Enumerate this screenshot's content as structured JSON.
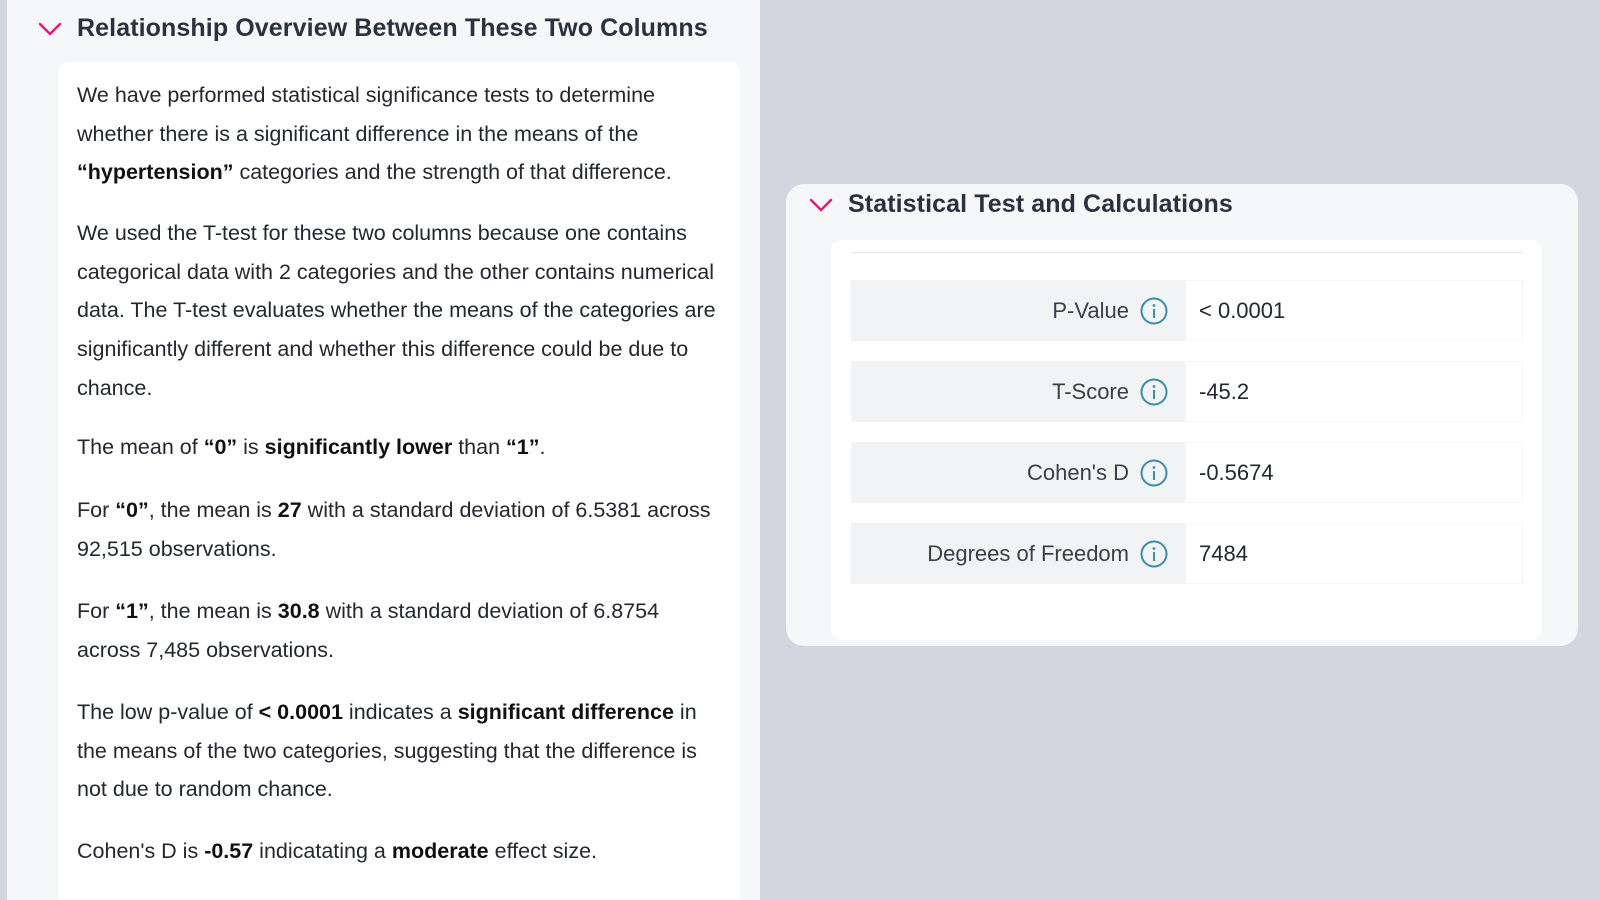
{
  "left_section": {
    "title": "Relationship Overview Between These Two Columns",
    "p1": {
      "t1": "We have performed statistical significance tests to determine whether there is a significant difference in the means of the ",
      "b1": "“hypertension”",
      "t2": " categories and the strength of that difference."
    },
    "p2": {
      "t1": "We used the T-test for these two columns because one contains categorical data with 2 categories and the other contains numerical data. The T-test evaluates whether the means of the categories are significantly different and whether this difference could be due to chance."
    },
    "p3": {
      "t1": "The mean of ",
      "b1": "“0”",
      "t2": " is ",
      "b2": "significantly lower",
      "t3": " than ",
      "b3": "“1”",
      "t4": "."
    },
    "p4": {
      "t1": "For ",
      "b1": "“0”",
      "t2": ", the mean is ",
      "b2": "27",
      "t3": " with a standard deviation of 6.5381 across 92,515 observations."
    },
    "p5": {
      "t1": "For ",
      "b1": "“1”",
      "t2": ", the mean is ",
      "b2": "30.8",
      "t3": " with a standard deviation of 6.8754 across 7,485 observations."
    },
    "p6": {
      "t1": "The low p-value of ",
      "b1": "< 0.0001",
      "t2": " indicates a ",
      "b2": "significant difference",
      "t3": " in the means of the two categories, suggesting that the difference is not due to random chance."
    },
    "p7": {
      "t1": "Cohen's D is ",
      "b1": "-0.57",
      "t2": " indicatating a ",
      "b2": "moderate",
      "t3": " effect size."
    }
  },
  "right_section": {
    "title": "Statistical Test and Calculations",
    "stats": [
      {
        "label": "P-Value",
        "value": "< 0.0001"
      },
      {
        "label": "T-Score",
        "value": "-45.2"
      },
      {
        "label": "Cohen's D",
        "value": "-0.5674"
      },
      {
        "label": "Degrees of Freedom",
        "value": "7484"
      }
    ]
  },
  "colors": {
    "accent_chevron": "#e0187a",
    "info_icon": "#3a8fa8"
  },
  "icons": {
    "collapse": "chevron-down-icon",
    "info": "info-icon"
  }
}
